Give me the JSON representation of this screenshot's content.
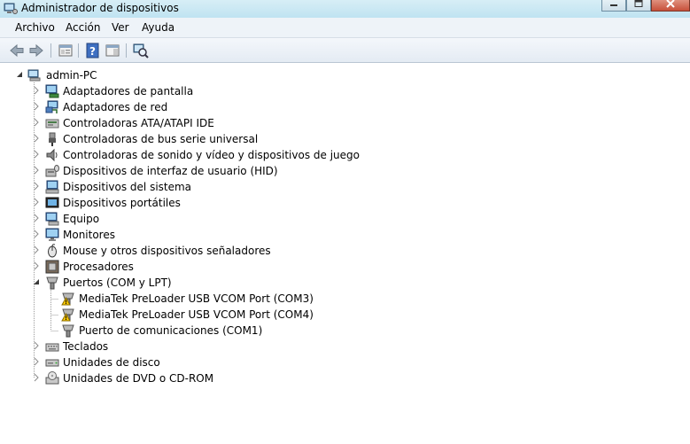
{
  "window": {
    "title": "Administrador de dispositivos"
  },
  "menu": {
    "items": [
      "Archivo",
      "Acción",
      "Ver",
      "Ayuda"
    ]
  },
  "toolbar": {
    "buttons": [
      "back-arrow-icon",
      "forward-arrow-icon",
      "properties-console-icon",
      "help-icon",
      "show-hide-pane-icon",
      "scan-hardware-icon"
    ]
  },
  "tree": {
    "root": "admin-PC",
    "categories": [
      "Adaptadores de pantalla",
      "Adaptadores de red",
      "Controladoras ATA/ATAPI IDE",
      "Controladoras de bus serie universal",
      "Controladoras de sonido y vídeo y dispositivos de juego",
      "Dispositivos de interfaz de usuario (HID)",
      "Dispositivos del sistema",
      "Dispositivos portátiles",
      "Equipo",
      "Monitores",
      "Mouse y otros dispositivos señaladores",
      "Procesadores",
      "Puertos (COM y LPT)",
      "Teclados",
      "Unidades de disco",
      "Unidades de DVD o CD-ROM"
    ],
    "ports_children": [
      "MediaTek PreLoader USB VCOM Port (COM3)",
      "MediaTek PreLoader USB VCOM Port (COM4)",
      "Puerto de comunicaciones (COM1)"
    ]
  }
}
